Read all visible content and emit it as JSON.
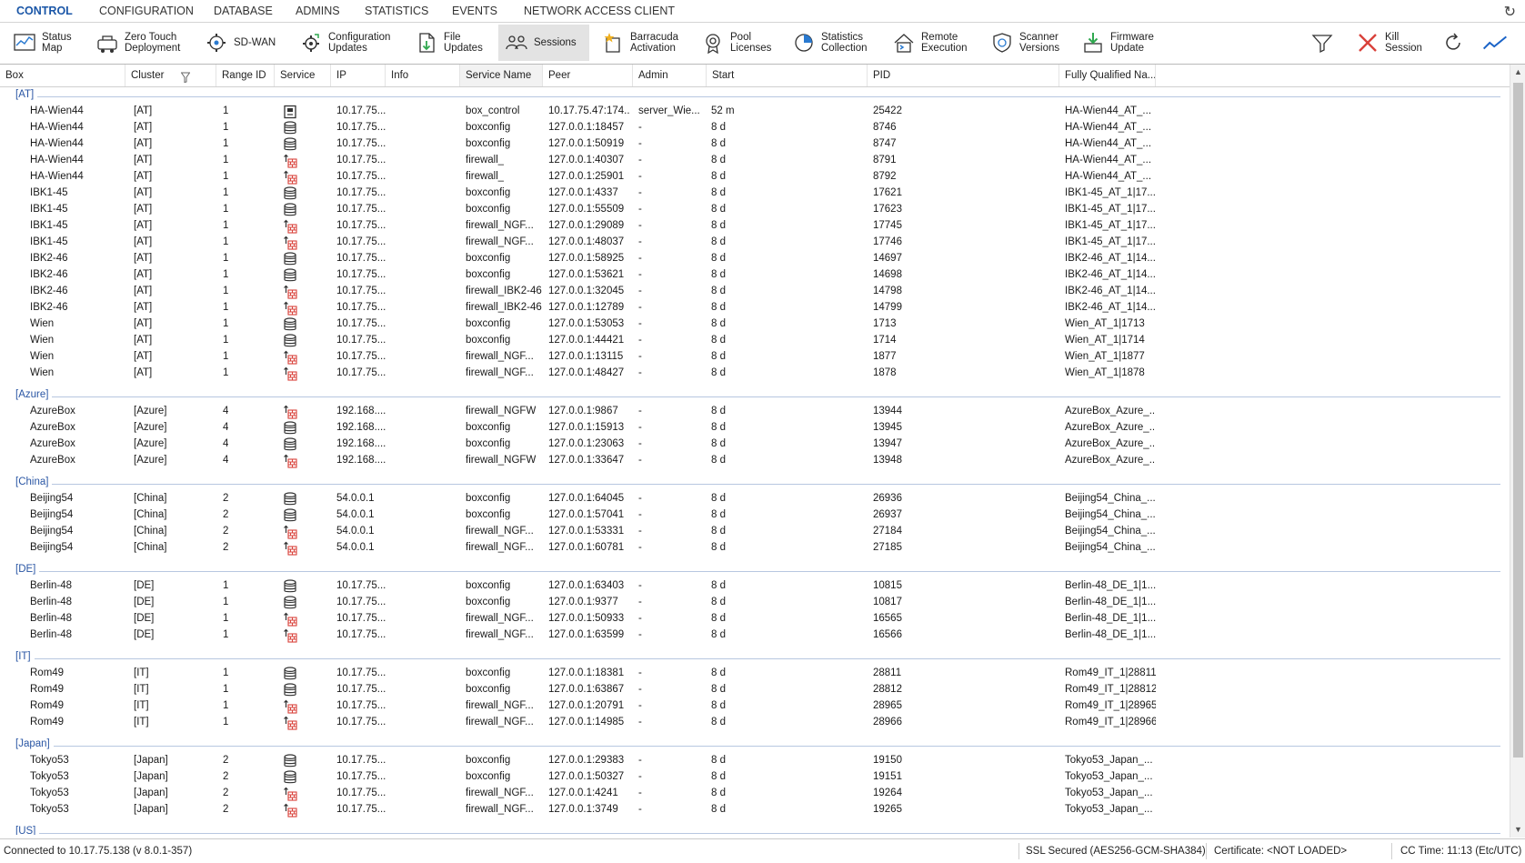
{
  "menu": {
    "items": [
      "CONTROL",
      "CONFIGURATION",
      "DATABASE",
      "ADMINS",
      "STATISTICS",
      "EVENTS",
      "NETWORK ACCESS CLIENT"
    ],
    "active_index": 0
  },
  "toolbar": {
    "buttons": [
      {
        "label": "Status\nMap",
        "icon": "status-map-icon"
      },
      {
        "label": "Zero Touch\nDeployment",
        "icon": "zero-touch-icon"
      },
      {
        "label": "SD-WAN",
        "icon": "sd-wan-icon"
      },
      {
        "label": "Configuration\nUpdates",
        "icon": "configuration-updates-icon"
      },
      {
        "label": "File\nUpdates",
        "icon": "file-updates-icon"
      },
      {
        "label": "Sessions",
        "icon": "sessions-icon"
      },
      {
        "label": "Barracuda\nActivation",
        "icon": "barracuda-activation-icon"
      },
      {
        "label": "Pool\nLicenses",
        "icon": "pool-licenses-icon"
      },
      {
        "label": "Statistics\nCollection",
        "icon": "statistics-collection-icon"
      },
      {
        "label": "Remote\nExecution",
        "icon": "remote-execution-icon"
      },
      {
        "label": "Scanner\nVersions",
        "icon": "scanner-versions-icon"
      },
      {
        "label": "Firmware\nUpdate",
        "icon": "firmware-update-icon"
      }
    ],
    "active_index": 5,
    "right": {
      "filter_icon": "filter-icon",
      "kill_label": "Kill\nSession",
      "refresh_icon": "refresh-icon",
      "chart_icon": "chart-icon"
    }
  },
  "columns": [
    "Box",
    "Cluster",
    "Range ID",
    "Service",
    "IP",
    "Info",
    "Service Name",
    "Peer",
    "Admin",
    "Start",
    "PID",
    "Fully Qualified Na..."
  ],
  "groups": [
    {
      "name": "[AT]",
      "rows": [
        {
          "box": "HA-Wien44",
          "cluster": "[AT]",
          "range": "1",
          "svc": "box",
          "ip": "10.17.75...",
          "info": "",
          "service_name": "box_control",
          "peer": "10.17.75.47:174...",
          "admin": "server_Wie...",
          "start": "52 m",
          "pid": "25422",
          "fqn": "HA-Wien44_AT_..."
        },
        {
          "box": "HA-Wien44",
          "cluster": "[AT]",
          "range": "1",
          "svc": "db",
          "ip": "10.17.75...",
          "info": "",
          "service_name": "boxconfig",
          "peer": "127.0.0.1:18457",
          "admin": "-",
          "start": "8 d",
          "pid": "8746",
          "fqn": "HA-Wien44_AT_..."
        },
        {
          "box": "HA-Wien44",
          "cluster": "[AT]",
          "range": "1",
          "svc": "db",
          "ip": "10.17.75...",
          "info": "",
          "service_name": "boxconfig",
          "peer": "127.0.0.1:50919",
          "admin": "-",
          "start": "8 d",
          "pid": "8747",
          "fqn": "HA-Wien44_AT_..."
        },
        {
          "box": "HA-Wien44",
          "cluster": "[AT]",
          "range": "1",
          "svc": "fw",
          "ip": "10.17.75...",
          "info": "",
          "service_name": "firewall_",
          "peer": "127.0.0.1:40307",
          "admin": "-",
          "start": "8 d",
          "pid": "8791",
          "fqn": "HA-Wien44_AT_..."
        },
        {
          "box": "HA-Wien44",
          "cluster": "[AT]",
          "range": "1",
          "svc": "fw",
          "ip": "10.17.75...",
          "info": "",
          "service_name": "firewall_",
          "peer": "127.0.0.1:25901",
          "admin": "-",
          "start": "8 d",
          "pid": "8792",
          "fqn": "HA-Wien44_AT_..."
        },
        {
          "box": "IBK1-45",
          "cluster": "[AT]",
          "range": "1",
          "svc": "db",
          "ip": "10.17.75...",
          "info": "",
          "service_name": "boxconfig",
          "peer": "127.0.0.1:4337",
          "admin": "-",
          "start": "8 d",
          "pid": "17621",
          "fqn": "IBK1-45_AT_1|17..."
        },
        {
          "box": "IBK1-45",
          "cluster": "[AT]",
          "range": "1",
          "svc": "db",
          "ip": "10.17.75...",
          "info": "",
          "service_name": "boxconfig",
          "peer": "127.0.0.1:55509",
          "admin": "-",
          "start": "8 d",
          "pid": "17623",
          "fqn": "IBK1-45_AT_1|17..."
        },
        {
          "box": "IBK1-45",
          "cluster": "[AT]",
          "range": "1",
          "svc": "fw",
          "ip": "10.17.75...",
          "info": "",
          "service_name": "firewall_NGF...",
          "peer": "127.0.0.1:29089",
          "admin": "-",
          "start": "8 d",
          "pid": "17745",
          "fqn": "IBK1-45_AT_1|17..."
        },
        {
          "box": "IBK1-45",
          "cluster": "[AT]",
          "range": "1",
          "svc": "fw",
          "ip": "10.17.75...",
          "info": "",
          "service_name": "firewall_NGF...",
          "peer": "127.0.0.1:48037",
          "admin": "-",
          "start": "8 d",
          "pid": "17746",
          "fqn": "IBK1-45_AT_1|17..."
        },
        {
          "box": "IBK2-46",
          "cluster": "[AT]",
          "range": "1",
          "svc": "db",
          "ip": "10.17.75...",
          "info": "",
          "service_name": "boxconfig",
          "peer": "127.0.0.1:58925",
          "admin": "-",
          "start": "8 d",
          "pid": "14697",
          "fqn": "IBK2-46_AT_1|14..."
        },
        {
          "box": "IBK2-46",
          "cluster": "[AT]",
          "range": "1",
          "svc": "db",
          "ip": "10.17.75...",
          "info": "",
          "service_name": "boxconfig",
          "peer": "127.0.0.1:53621",
          "admin": "-",
          "start": "8 d",
          "pid": "14698",
          "fqn": "IBK2-46_AT_1|14..."
        },
        {
          "box": "IBK2-46",
          "cluster": "[AT]",
          "range": "1",
          "svc": "fw",
          "ip": "10.17.75...",
          "info": "",
          "service_name": "firewall_IBK2-46",
          "peer": "127.0.0.1:32045",
          "admin": "-",
          "start": "8 d",
          "pid": "14798",
          "fqn": "IBK2-46_AT_1|14..."
        },
        {
          "box": "IBK2-46",
          "cluster": "[AT]",
          "range": "1",
          "svc": "fw",
          "ip": "10.17.75...",
          "info": "",
          "service_name": "firewall_IBK2-46",
          "peer": "127.0.0.1:12789",
          "admin": "-",
          "start": "8 d",
          "pid": "14799",
          "fqn": "IBK2-46_AT_1|14..."
        },
        {
          "box": "Wien",
          "cluster": "[AT]",
          "range": "1",
          "svc": "db",
          "ip": "10.17.75...",
          "info": "",
          "service_name": "boxconfig",
          "peer": "127.0.0.1:53053",
          "admin": "-",
          "start": "8 d",
          "pid": "1713",
          "fqn": "Wien_AT_1|1713"
        },
        {
          "box": "Wien",
          "cluster": "[AT]",
          "range": "1",
          "svc": "db",
          "ip": "10.17.75...",
          "info": "",
          "service_name": "boxconfig",
          "peer": "127.0.0.1:44421",
          "admin": "-",
          "start": "8 d",
          "pid": "1714",
          "fqn": "Wien_AT_1|1714"
        },
        {
          "box": "Wien",
          "cluster": "[AT]",
          "range": "1",
          "svc": "fw",
          "ip": "10.17.75...",
          "info": "",
          "service_name": "firewall_NGF...",
          "peer": "127.0.0.1:13115",
          "admin": "-",
          "start": "8 d",
          "pid": "1877",
          "fqn": "Wien_AT_1|1877"
        },
        {
          "box": "Wien",
          "cluster": "[AT]",
          "range": "1",
          "svc": "fw",
          "ip": "10.17.75...",
          "info": "",
          "service_name": "firewall_NGF...",
          "peer": "127.0.0.1:48427",
          "admin": "-",
          "start": "8 d",
          "pid": "1878",
          "fqn": "Wien_AT_1|1878"
        }
      ]
    },
    {
      "name": "[Azure]",
      "rows": [
        {
          "box": "AzureBox",
          "cluster": "[Azure]",
          "range": "4",
          "svc": "fw",
          "ip": "192.168....",
          "info": "",
          "service_name": "firewall_NGFW",
          "peer": "127.0.0.1:9867",
          "admin": "-",
          "start": "8 d",
          "pid": "13944",
          "fqn": "AzureBox_Azure_..."
        },
        {
          "box": "AzureBox",
          "cluster": "[Azure]",
          "range": "4",
          "svc": "db",
          "ip": "192.168....",
          "info": "",
          "service_name": "boxconfig",
          "peer": "127.0.0.1:15913",
          "admin": "-",
          "start": "8 d",
          "pid": "13945",
          "fqn": "AzureBox_Azure_..."
        },
        {
          "box": "AzureBox",
          "cluster": "[Azure]",
          "range": "4",
          "svc": "db",
          "ip": "192.168....",
          "info": "",
          "service_name": "boxconfig",
          "peer": "127.0.0.1:23063",
          "admin": "-",
          "start": "8 d",
          "pid": "13947",
          "fqn": "AzureBox_Azure_..."
        },
        {
          "box": "AzureBox",
          "cluster": "[Azure]",
          "range": "4",
          "svc": "fw",
          "ip": "192.168....",
          "info": "",
          "service_name": "firewall_NGFW",
          "peer": "127.0.0.1:33647",
          "admin": "-",
          "start": "8 d",
          "pid": "13948",
          "fqn": "AzureBox_Azure_..."
        }
      ]
    },
    {
      "name": "[China]",
      "rows": [
        {
          "box": "Beijing54",
          "cluster": "[China]",
          "range": "2",
          "svc": "db",
          "ip": "54.0.0.1",
          "info": "",
          "service_name": "boxconfig",
          "peer": "127.0.0.1:64045",
          "admin": "-",
          "start": "8 d",
          "pid": "26936",
          "fqn": "Beijing54_China_..."
        },
        {
          "box": "Beijing54",
          "cluster": "[China]",
          "range": "2",
          "svc": "db",
          "ip": "54.0.0.1",
          "info": "",
          "service_name": "boxconfig",
          "peer": "127.0.0.1:57041",
          "admin": "-",
          "start": "8 d",
          "pid": "26937",
          "fqn": "Beijing54_China_..."
        },
        {
          "box": "Beijing54",
          "cluster": "[China]",
          "range": "2",
          "svc": "fw",
          "ip": "54.0.0.1",
          "info": "",
          "service_name": "firewall_NGF...",
          "peer": "127.0.0.1:53331",
          "admin": "-",
          "start": "8 d",
          "pid": "27184",
          "fqn": "Beijing54_China_..."
        },
        {
          "box": "Beijing54",
          "cluster": "[China]",
          "range": "2",
          "svc": "fw",
          "ip": "54.0.0.1",
          "info": "",
          "service_name": "firewall_NGF...",
          "peer": "127.0.0.1:60781",
          "admin": "-",
          "start": "8 d",
          "pid": "27185",
          "fqn": "Beijing54_China_..."
        }
      ]
    },
    {
      "name": "[DE]",
      "rows": [
        {
          "box": "Berlin-48",
          "cluster": "[DE]",
          "range": "1",
          "svc": "db",
          "ip": "10.17.75...",
          "info": "",
          "service_name": "boxconfig",
          "peer": "127.0.0.1:63403",
          "admin": "-",
          "start": "8 d",
          "pid": "10815",
          "fqn": "Berlin-48_DE_1|1..."
        },
        {
          "box": "Berlin-48",
          "cluster": "[DE]",
          "range": "1",
          "svc": "db",
          "ip": "10.17.75...",
          "info": "",
          "service_name": "boxconfig",
          "peer": "127.0.0.1:9377",
          "admin": "-",
          "start": "8 d",
          "pid": "10817",
          "fqn": "Berlin-48_DE_1|1..."
        },
        {
          "box": "Berlin-48",
          "cluster": "[DE]",
          "range": "1",
          "svc": "fw",
          "ip": "10.17.75...",
          "info": "",
          "service_name": "firewall_NGF...",
          "peer": "127.0.0.1:50933",
          "admin": "-",
          "start": "8 d",
          "pid": "16565",
          "fqn": "Berlin-48_DE_1|1..."
        },
        {
          "box": "Berlin-48",
          "cluster": "[DE]",
          "range": "1",
          "svc": "fw",
          "ip": "10.17.75...",
          "info": "",
          "service_name": "firewall_NGF...",
          "peer": "127.0.0.1:63599",
          "admin": "-",
          "start": "8 d",
          "pid": "16566",
          "fqn": "Berlin-48_DE_1|1..."
        }
      ]
    },
    {
      "name": "[IT]",
      "rows": [
        {
          "box": "Rom49",
          "cluster": "[IT]",
          "range": "1",
          "svc": "db",
          "ip": "10.17.75...",
          "info": "",
          "service_name": "boxconfig",
          "peer": "127.0.0.1:18381",
          "admin": "-",
          "start": "8 d",
          "pid": "28811",
          "fqn": "Rom49_IT_1|28811"
        },
        {
          "box": "Rom49",
          "cluster": "[IT]",
          "range": "1",
          "svc": "db",
          "ip": "10.17.75...",
          "info": "",
          "service_name": "boxconfig",
          "peer": "127.0.0.1:63867",
          "admin": "-",
          "start": "8 d",
          "pid": "28812",
          "fqn": "Rom49_IT_1|28812"
        },
        {
          "box": "Rom49",
          "cluster": "[IT]",
          "range": "1",
          "svc": "fw",
          "ip": "10.17.75...",
          "info": "",
          "service_name": "firewall_NGF...",
          "peer": "127.0.0.1:20791",
          "admin": "-",
          "start": "8 d",
          "pid": "28965",
          "fqn": "Rom49_IT_1|28965"
        },
        {
          "box": "Rom49",
          "cluster": "[IT]",
          "range": "1",
          "svc": "fw",
          "ip": "10.17.75...",
          "info": "",
          "service_name": "firewall_NGF...",
          "peer": "127.0.0.1:14985",
          "admin": "-",
          "start": "8 d",
          "pid": "28966",
          "fqn": "Rom49_IT_1|28966"
        }
      ]
    },
    {
      "name": "[Japan]",
      "rows": [
        {
          "box": "Tokyo53",
          "cluster": "[Japan]",
          "range": "2",
          "svc": "db",
          "ip": "10.17.75...",
          "info": "",
          "service_name": "boxconfig",
          "peer": "127.0.0.1:29383",
          "admin": "-",
          "start": "8 d",
          "pid": "19150",
          "fqn": "Tokyo53_Japan_..."
        },
        {
          "box": "Tokyo53",
          "cluster": "[Japan]",
          "range": "2",
          "svc": "db",
          "ip": "10.17.75...",
          "info": "",
          "service_name": "boxconfig",
          "peer": "127.0.0.1:50327",
          "admin": "-",
          "start": "8 d",
          "pid": "19151",
          "fqn": "Tokyo53_Japan_..."
        },
        {
          "box": "Tokyo53",
          "cluster": "[Japan]",
          "range": "2",
          "svc": "fw",
          "ip": "10.17.75...",
          "info": "",
          "service_name": "firewall_NGF...",
          "peer": "127.0.0.1:4241",
          "admin": "-",
          "start": "8 d",
          "pid": "19264",
          "fqn": "Tokyo53_Japan_..."
        },
        {
          "box": "Tokyo53",
          "cluster": "[Japan]",
          "range": "2",
          "svc": "fw",
          "ip": "10.17.75...",
          "info": "",
          "service_name": "firewall_NGF...",
          "peer": "127.0.0.1:3749",
          "admin": "-",
          "start": "8 d",
          "pid": "19265",
          "fqn": "Tokyo53_Japan_..."
        }
      ]
    },
    {
      "name": "[US]",
      "rows": []
    }
  ],
  "status": {
    "connected": "Connected to 10.17.75.138 (v 8.0.1-357)",
    "ssl": "SSL Secured (AES256-GCM-SHA384)",
    "certificate": "Certificate: <NOT LOADED>",
    "cc_time": "CC Time: 11:13 (Etc/UTC)"
  },
  "colors": {
    "accent": "#1a56a7",
    "group_text": "#2a56a4",
    "firewall_red": "#d9413a"
  }
}
